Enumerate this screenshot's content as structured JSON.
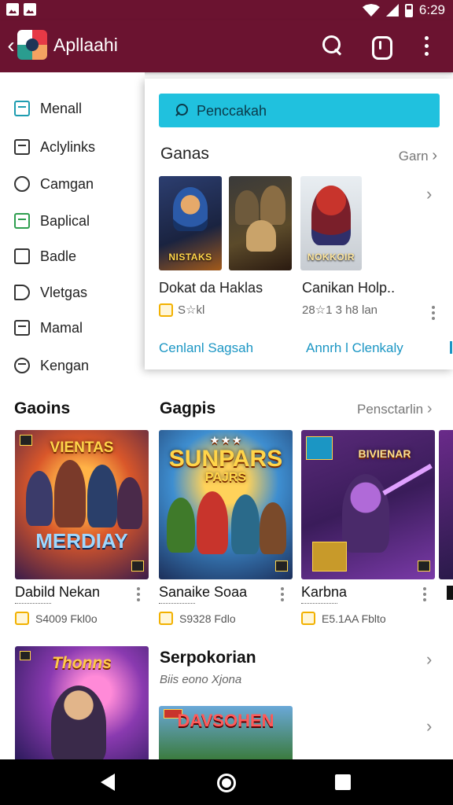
{
  "status_bar": {
    "time": "6:29"
  },
  "app_bar": {
    "title": "Apllaahi",
    "icons": [
      "back-arrow-icon",
      "app-logo",
      "search-icon",
      "notification-icon",
      "more-vert-icon"
    ]
  },
  "sidebar": {
    "items": [
      {
        "label": "Menall",
        "icon": "calendar-icon"
      },
      {
        "label": "Aclylinks",
        "icon": "window-icon"
      },
      {
        "label": "Camgan",
        "icon": "refresh-circle-icon"
      },
      {
        "label": "Baplical",
        "icon": "bag-icon"
      },
      {
        "label": "Badle",
        "icon": "bookmark-icon"
      },
      {
        "label": "Vletgas",
        "icon": "megaphone-icon"
      },
      {
        "label": "Mamal",
        "icon": "building-icon"
      },
      {
        "label": "Kengan",
        "icon": "globe-icon"
      }
    ]
  },
  "popup": {
    "search_placeholder": "Penccakah",
    "section_title": "Ganas",
    "section_more": "Garn",
    "items": [
      {
        "title": "Dokat da Haklas",
        "meta": "S☆kl",
        "cover_text": "NISTAKS"
      },
      {
        "title": "Canikan Holp..",
        "meta": "28☆1 3 h8 lan",
        "cover_text": "NOKKOIR"
      }
    ],
    "links": [
      "Cenlanl Sagsah",
      "Annrh l Clenkaly"
    ]
  },
  "section1": {
    "left_title": "Gaoins",
    "title": "Gagpis",
    "more": "Pensctarlin",
    "cards": [
      {
        "title": "Dabild Nekan",
        "meta": "S4009 Fkl0o",
        "cover_top": "VIENTAS",
        "cover_bottom": "MERDIAY"
      },
      {
        "title": "Sanaike Soaa",
        "meta": "S9328 Fdlo",
        "cover_top": "SUNPARS",
        "cover_bottom": "PAJRS"
      },
      {
        "title": "Karbna",
        "meta": "E5.1AA Fblto",
        "cover_top": "BIVIENAR",
        "cover_bottom": ""
      }
    ]
  },
  "section2": {
    "title": "Serpokorian",
    "subtitle": "Biis eono Xjona",
    "left_card_cover": "Thonns",
    "card_cover": "DAVSOHEN"
  },
  "nav_bar": {
    "icons": [
      "nav-back-icon",
      "nav-home-icon",
      "nav-recents-icon"
    ]
  },
  "colors": {
    "primary": "#6b1330",
    "accent": "#20c1de",
    "link": "#1b96c4",
    "rating": "#f2b100"
  }
}
